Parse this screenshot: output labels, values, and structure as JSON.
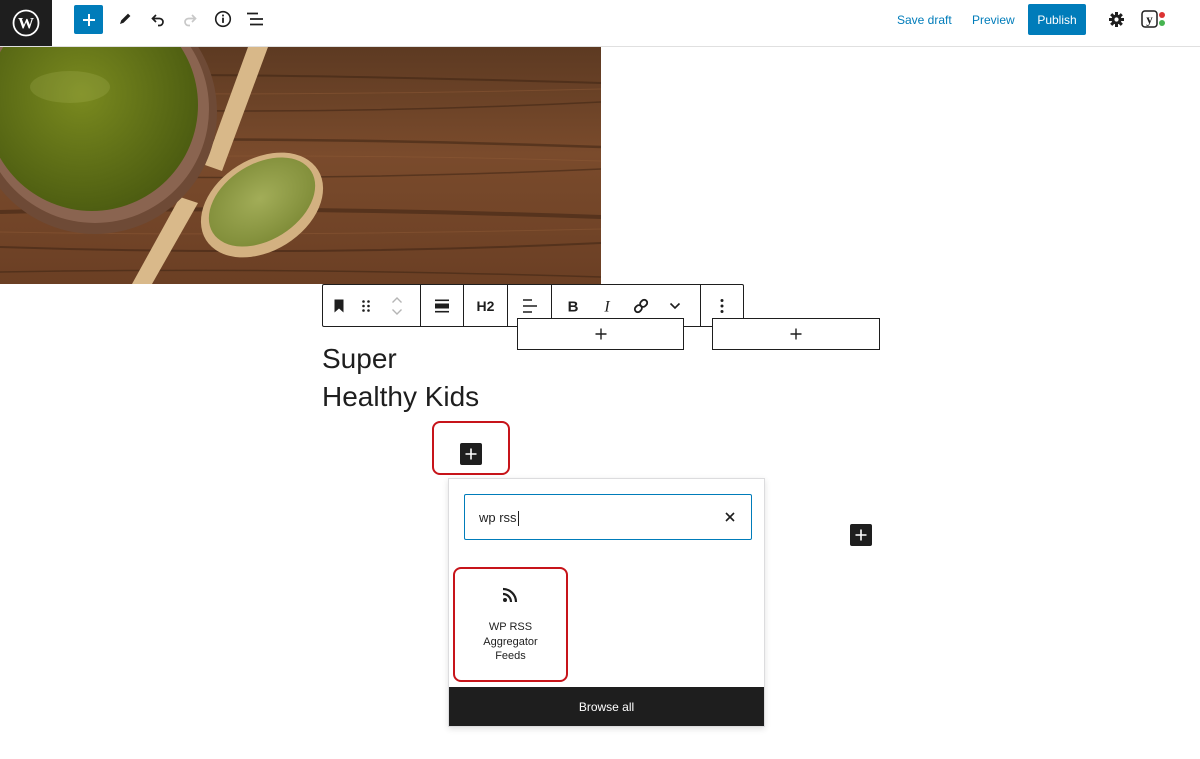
{
  "topbar": {
    "save_draft": "Save draft",
    "preview": "Preview",
    "publish": "Publish",
    "icons": [
      "wordpress-logo-icon",
      "plus-icon",
      "pencil-icon",
      "undo-icon",
      "redo-icon",
      "info-icon",
      "list-view-icon",
      "gear-icon",
      "yoast-icon"
    ]
  },
  "block_toolbar": {
    "heading_level": "H2",
    "icons": [
      "bookmark-icon",
      "drag-handle-icon",
      "move-up-icon",
      "move-down-icon",
      "align-wide-icon",
      "text-align-icon",
      "bold-icon",
      "italic-icon",
      "link-icon",
      "chevron-down-icon",
      "more-options-icon"
    ]
  },
  "columns": {
    "placeholder_icon": "plus-icon"
  },
  "heading": {
    "line1": "Super",
    "line2": "Healthy Kids"
  },
  "inserter": {
    "search_value": "wp rss",
    "result": {
      "icon": "rss-icon",
      "label_line1": "WP RSS",
      "label_line2": "Aggregator",
      "label_line3": "Feeds"
    },
    "browse_all": "Browse all"
  },
  "colors": {
    "accent": "#007cba",
    "dark": "#1e1e1e",
    "highlight": "#c7141a",
    "yoast_dot_red": "#dc3232",
    "yoast_dot_green": "#46b450"
  }
}
